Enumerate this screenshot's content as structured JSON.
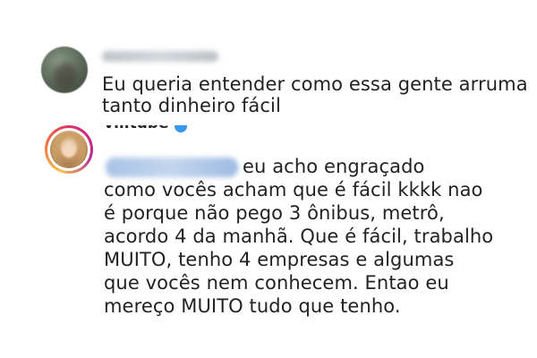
{
  "comments": [
    {
      "avatar_icon": "blurred-user-photo-icon",
      "lines": [
        "Eu queria entender como essa gente arruma",
        "tanto dinheiro fácil"
      ]
    }
  ],
  "reply": {
    "username": "viiitube",
    "verified": true,
    "avatar_icon": "user-photo-with-story-ring-icon",
    "lines": [
      "eu acho engraçado",
      "como vocês acham que é fácil kkkk nao",
      "é porque não pego 3 ônibus, metrô,",
      "acordo 4 da manhã. Que é fácil, trabalho",
      "MUITO, tenho 4 empresas e algumas",
      "que vocês nem conhecem. Entao eu",
      "mereço MUITO tudo que tenho."
    ]
  },
  "colors": {
    "story_ring": [
      "#f9c04a",
      "#f26a3e",
      "#d8296e",
      "#b52f8f"
    ],
    "verified_badge": "#3897f0",
    "mention_blur": "#a8c4e6"
  }
}
